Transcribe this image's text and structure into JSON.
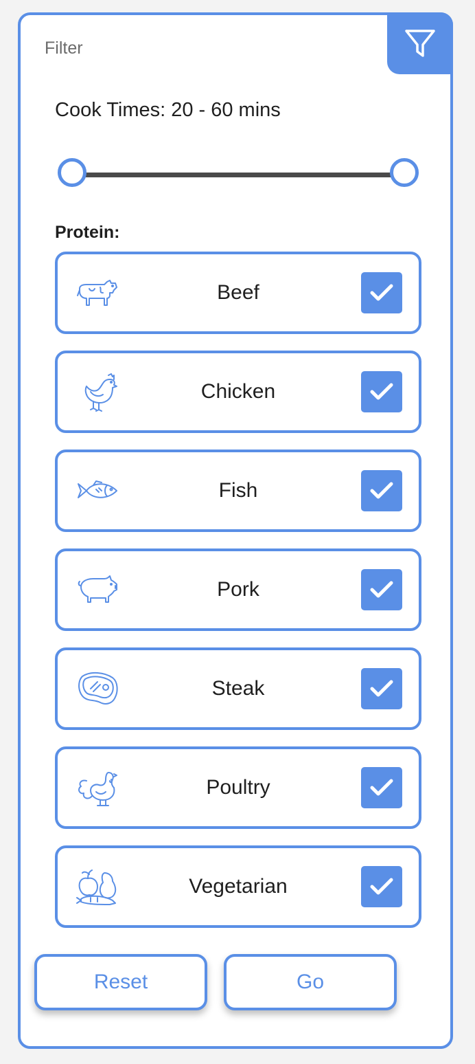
{
  "header": {
    "title": "Filter",
    "filter_icon": "funnel-icon"
  },
  "cook_times": {
    "label": "Cook Times: 20 - 60 mins",
    "min": 20,
    "max": 60,
    "unit": "mins"
  },
  "protein": {
    "heading": "Protein:",
    "options": [
      {
        "label": "Beef",
        "icon": "cow-icon",
        "checked": true
      },
      {
        "label": "Chicken",
        "icon": "chicken-icon",
        "checked": true
      },
      {
        "label": "Fish",
        "icon": "fish-icon",
        "checked": true
      },
      {
        "label": "Pork",
        "icon": "pig-icon",
        "checked": true
      },
      {
        "label": "Steak",
        "icon": "steak-icon",
        "checked": true
      },
      {
        "label": "Poultry",
        "icon": "turkey-icon",
        "checked": true
      },
      {
        "label": "Vegetarian",
        "icon": "vegetables-icon",
        "checked": true
      }
    ]
  },
  "buttons": {
    "reset_label": "Reset",
    "go_label": "Go"
  },
  "colors": {
    "accent": "#5a8fe6",
    "text": "#1f1f1f",
    "muted": "#6b6b6b"
  }
}
